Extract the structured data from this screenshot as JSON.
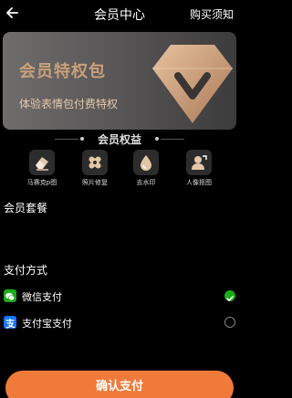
{
  "header": {
    "title": "会员中心",
    "notice": "购买须知"
  },
  "banner": {
    "title": "会员特权包",
    "subtitle": "体验表情包付费特权"
  },
  "benefits": {
    "title": "会员权益",
    "items": [
      {
        "label": "马赛克p图",
        "icon": "eraser-icon"
      },
      {
        "label": "照片修复",
        "icon": "bandage-icon"
      },
      {
        "label": "去水印",
        "icon": "drop-icon"
      },
      {
        "label": "人像抠图",
        "icon": "portrait-icon"
      }
    ]
  },
  "plans": {
    "title": "会员套餐"
  },
  "payment": {
    "title": "支付方式",
    "methods": [
      {
        "label": "微信支付",
        "selected": true,
        "color": "#1aad19"
      },
      {
        "label": "支付宝支付",
        "selected": false,
        "color": "#1677ff"
      }
    ]
  },
  "confirm_label": "确认支付",
  "colors": {
    "accent": "#f07a3a",
    "gold": "#c9a07b",
    "wechat": "#1aad19",
    "alipay": "#1677ff"
  }
}
